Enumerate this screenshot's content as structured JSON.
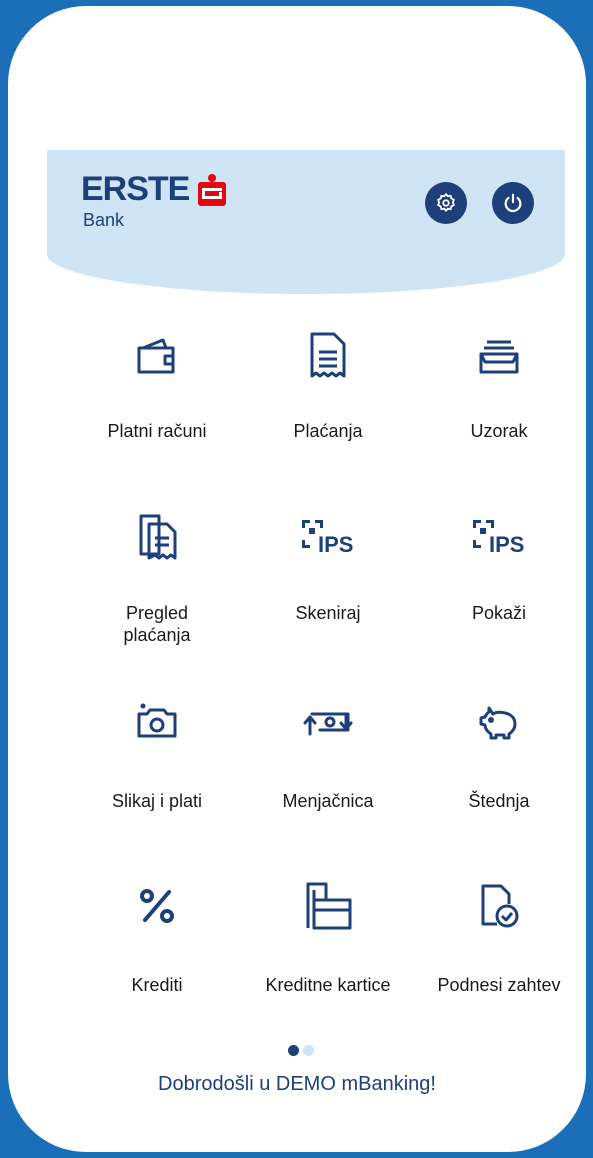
{
  "brand": {
    "name": "ERSTE",
    "sub": "Bank"
  },
  "header": {
    "settings_icon": "gear-icon",
    "power_icon": "power-icon"
  },
  "tiles": [
    {
      "label": "Platni računi",
      "icon": "wallet-icon"
    },
    {
      "label": "Plaćanja",
      "icon": "document-icon"
    },
    {
      "label": "Uzorak",
      "icon": "tray-icon"
    },
    {
      "label": "Pregled plaćanja",
      "icon": "documents-stack-icon"
    },
    {
      "label": "Skeniraj",
      "icon": "ips-scan-icon"
    },
    {
      "label": "Pokaži",
      "icon": "ips-show-icon"
    },
    {
      "label": "Slikaj i plati",
      "icon": "camera-icon"
    },
    {
      "label": "Menjačnica",
      "icon": "exchange-icon"
    },
    {
      "label": "Štednja",
      "icon": "piggy-bank-icon"
    },
    {
      "label": "Krediti",
      "icon": "percent-icon"
    },
    {
      "label": "Kreditne kartice",
      "icon": "card-icon"
    },
    {
      "label": "Podnesi zahtev",
      "icon": "request-icon"
    }
  ],
  "pager": {
    "active": 1,
    "total": 2
  },
  "welcome": "Dobrodošli u DEMO mBanking!",
  "colors": {
    "brand_blue": "#1d3f7a",
    "header_bg": "#cfe4f4",
    "frame_blue": "#1b6fb8",
    "erste_red": "#e30613"
  }
}
